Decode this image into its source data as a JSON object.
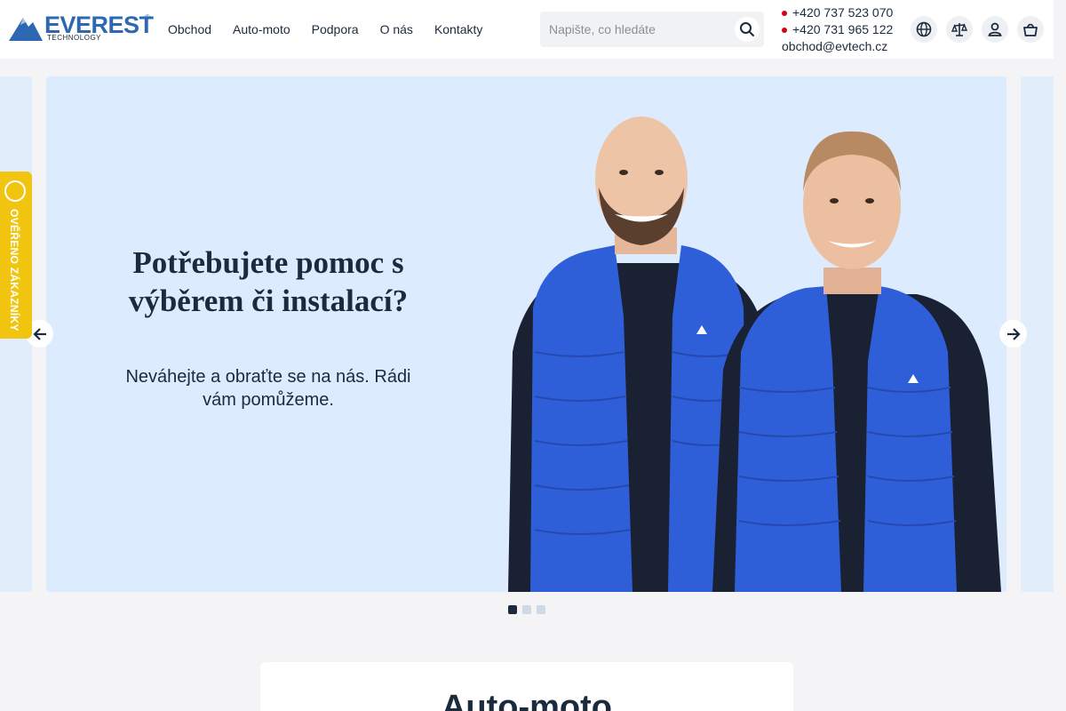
{
  "header": {
    "logo": {
      "word": "EVEREST",
      "sub": "TECHNOLOGY",
      "reg": "®"
    },
    "nav": [
      "Obchod",
      "Auto-moto",
      "Podpora",
      "O nás",
      "Kontakty"
    ],
    "search": {
      "placeholder": "Napište, co hledáte"
    },
    "contacts": {
      "phone1": "+420 737 523 070",
      "phone2": "+420 731 965 122",
      "email": "obchod@evtech.cz"
    },
    "icons": [
      "globe-icon",
      "compare-icon",
      "user-icon",
      "basket-icon"
    ]
  },
  "hero": {
    "title": "Potřebujete pomoc s výběrem či instalací?",
    "text": "Neváhejte a obraťte se na nás. Rádi vám pomůžeme.",
    "slides_total": 3,
    "active_slide": 1
  },
  "badge": {
    "text": "OVĚŘENO ZÁKAZNÍKY"
  },
  "section": {
    "title": "Auto-moto"
  },
  "colors": {
    "accent": "#2d69b3",
    "text": "#1b2a3d",
    "hero_bg": "#dcebfd",
    "badge": "#f1c40f",
    "vest": "#2f5fd8"
  }
}
